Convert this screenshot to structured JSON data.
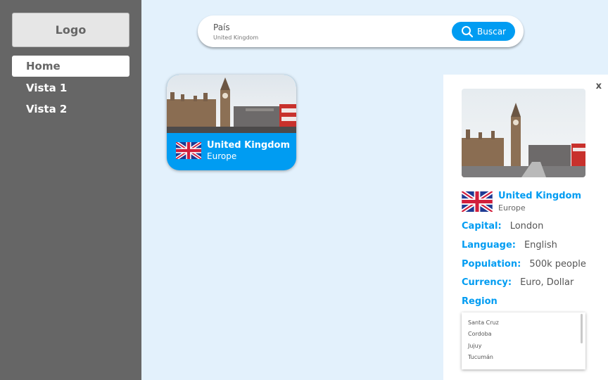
{
  "sidebar": {
    "logo": "Logo",
    "items": [
      {
        "label": "Home",
        "active": true
      },
      {
        "label": "Vista 1",
        "active": false
      },
      {
        "label": "Vista 2",
        "active": false
      }
    ]
  },
  "search": {
    "label": "País",
    "value": "United Kingdom",
    "button_label": "Buscar",
    "button_icon": "search-icon"
  },
  "card": {
    "name": "United Kingdom",
    "region": "Europe",
    "flag_icon": "uk-flag-icon"
  },
  "detail": {
    "close": "x",
    "name": "United Kingdom",
    "region": "Europe",
    "capital": {
      "label": "Capital:",
      "value": "London"
    },
    "language": {
      "label": "Language:",
      "value": "English"
    },
    "population": {
      "label": "Population:",
      "value": "500k people"
    },
    "currency": {
      "label": "Currency:",
      "value": "Euro, Dollar"
    },
    "region_label": "Region",
    "region_options": [
      "Santa Cruz",
      "Cordoba",
      "Jujuy",
      "Tucumán"
    ]
  },
  "colors": {
    "accent": "#009cf2",
    "sidebar": "#666666",
    "background": "#e3f1fc"
  }
}
